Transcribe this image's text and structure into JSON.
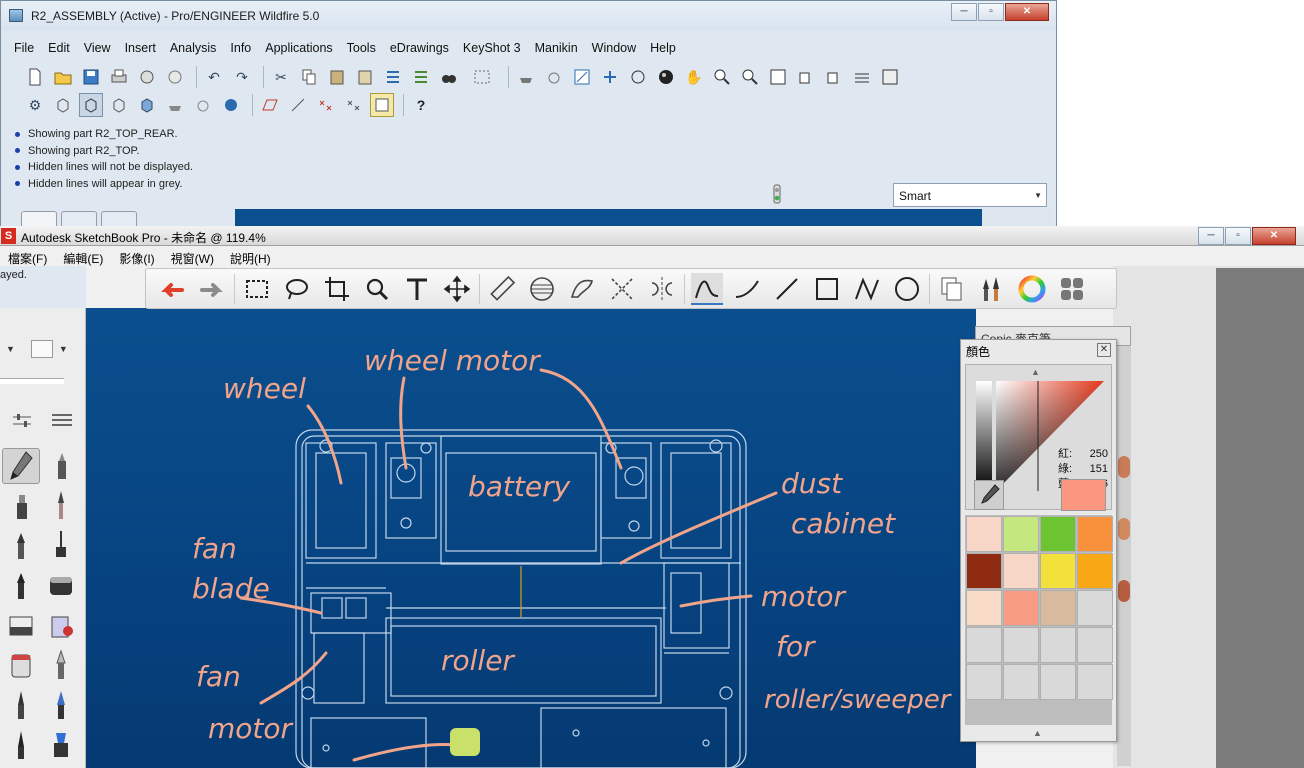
{
  "proe": {
    "title": "R2_ASSEMBLY (Active) - Pro/ENGINEER Wildfire 5.0",
    "menu": [
      "File",
      "Edit",
      "View",
      "Insert",
      "Analysis",
      "Info",
      "Applications",
      "Tools",
      "eDrawings",
      "KeyShot 3",
      "Manikin",
      "Window",
      "Help"
    ],
    "messages": [
      "Showing part R2_TOP_REAR.",
      "Showing part R2_TOP.",
      "Hidden lines will not be displayed.",
      "Hidden lines will appear in grey."
    ],
    "filter_value": "Smart",
    "peek_text": "ayed."
  },
  "sketchbook": {
    "title": "Autodesk SketchBook Pro - 未命名 @ 119.4%",
    "menu": [
      "檔案(F)",
      "編輯(E)",
      "影像(I)",
      "視窗(W)",
      "說明(H)"
    ],
    "color_panel": {
      "title": "顏色",
      "back_title": "Copic 麥克筆",
      "labels": {
        "r": "紅:",
        "g": "綠:",
        "b": "藍:"
      },
      "values": {
        "r": "250",
        "g": "151",
        "b": "126"
      },
      "current_color": "#fa977e",
      "swatches": [
        "#f7d6c8",
        "#c4e87f",
        "#6cc430",
        "#f8913c",
        "#8e2b11",
        "#f7d6c8",
        "#f4e03a",
        "#f8a814",
        "#f8dcc8",
        "#f79b83",
        "#d8bb9c",
        "#d9d9d9",
        "#d9d9d9",
        "#d9d9d9",
        "#d9d9d9",
        "#d9d9d9",
        "#d9d9d9",
        "#d9d9d9",
        "#d9d9d9",
        "#d9d9d9"
      ]
    },
    "annotations": [
      "wheel",
      "wheel motor",
      "battery",
      "dust",
      "cabinet",
      "fan",
      "blade",
      "motor",
      "for",
      "roller/sweeper",
      "roller",
      "fan",
      "motor"
    ],
    "ink_color": "#f2a48b",
    "canvas_color": "#0b4f8e"
  }
}
